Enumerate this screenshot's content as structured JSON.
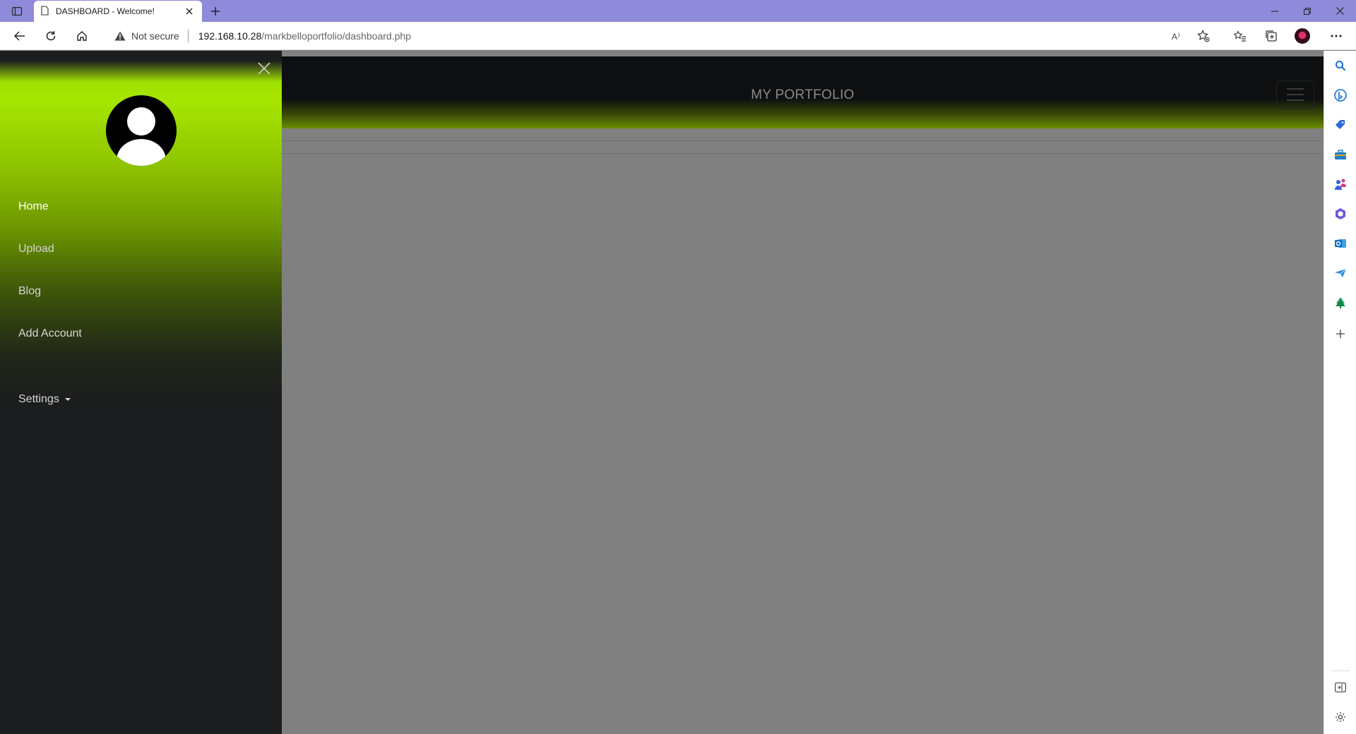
{
  "browser": {
    "tab_title": "DASHBOARD - Welcome!",
    "security_label": "Not secure",
    "url_host": "192.168.10.28",
    "url_path": "/markbelloportfolio/dashboard.php"
  },
  "navbar": {
    "brand": "MY PORTFOLIO"
  },
  "sidebar": {
    "items": [
      {
        "label": "Home",
        "active": true
      },
      {
        "label": "Upload",
        "active": false
      },
      {
        "label": "Blog",
        "active": false
      },
      {
        "label": "Add Account",
        "active": false
      }
    ],
    "settings_label": "Settings"
  },
  "colors": {
    "tabstrip": "#8f8ad9",
    "sidebar_accent": "#a6e600",
    "sidebar_dark": "#1b1d1f",
    "overlay": "#808080"
  },
  "icons": {
    "edge_sidebar": [
      "search-icon",
      "bing-chat-icon",
      "shopping-tag-icon",
      "tools-icon",
      "games-icon",
      "office-icon",
      "outlook-icon",
      "send-icon",
      "tree-icon",
      "add-icon"
    ]
  }
}
